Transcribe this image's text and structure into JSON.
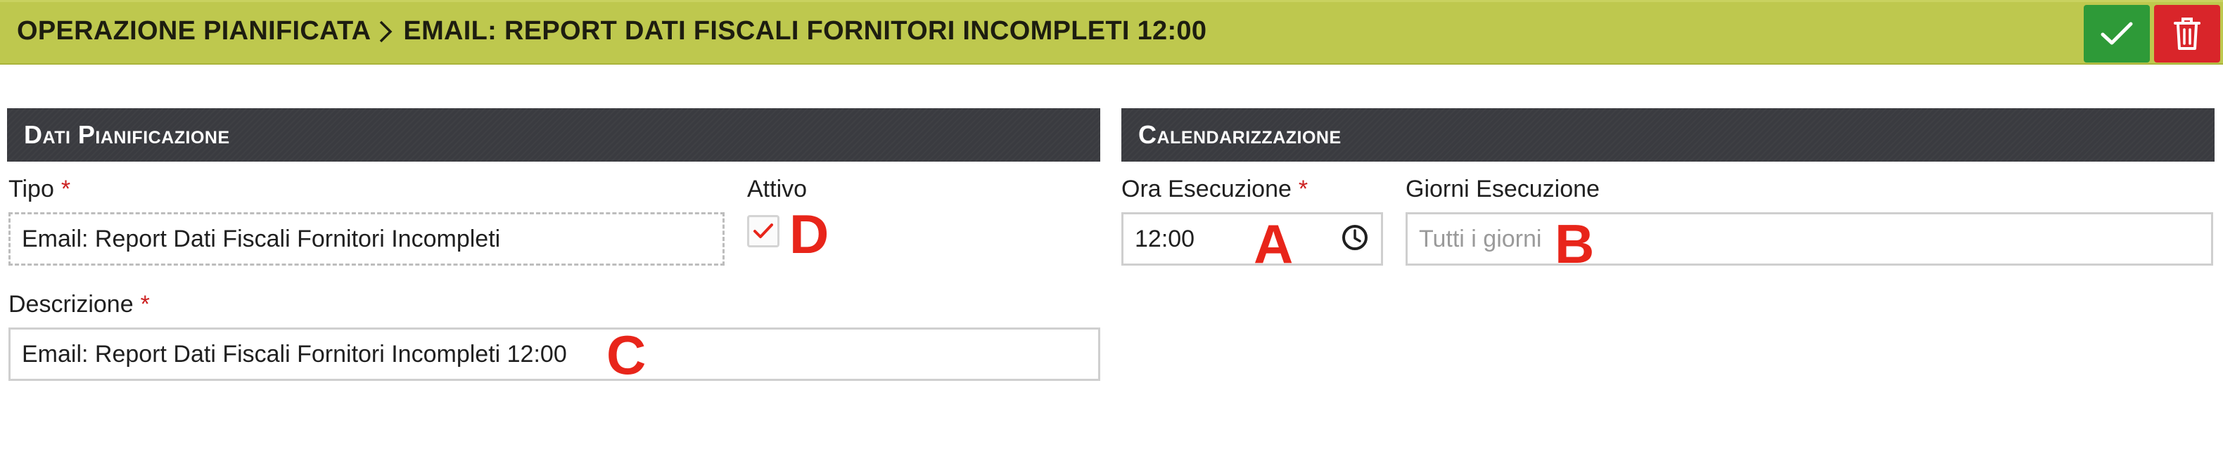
{
  "header": {
    "section": "OPERAZIONE PIANIFICATA",
    "title": "EMAIL: REPORT DATI FISCALI FORNITORI INCOMPLETI 12:00",
    "save_icon": "check-icon",
    "delete_icon": "trash-icon"
  },
  "dati_pianificazione": {
    "title": "Dati Pianificazione",
    "tipo": {
      "label": "Tipo",
      "required": "*",
      "value": "Email: Report Dati Fiscali Fornitori Incompleti"
    },
    "attivo": {
      "label": "Attivo",
      "checked": true
    },
    "descrizione": {
      "label": "Descrizione",
      "required": "*",
      "value": "Email: Report Dati Fiscali Fornitori Incompleti 12:00"
    }
  },
  "calendarizzazione": {
    "title": "Calendarizzazione",
    "ora_esecuzione": {
      "label": "Ora Esecuzione",
      "required": "*",
      "value": "12:00",
      "icon": "clock-icon"
    },
    "giorni_esecuzione": {
      "label": "Giorni Esecuzione",
      "placeholder": "Tutti i giorni"
    }
  },
  "markers": {
    "a": "A",
    "b": "B",
    "c": "C",
    "d": "D"
  },
  "colors": {
    "header_bg": "#bec84e",
    "save": "#2e9a38",
    "delete": "#d9252a",
    "panel_header": "#3a3b40",
    "required": "#cc1f1f",
    "marker": "#e8251a"
  }
}
